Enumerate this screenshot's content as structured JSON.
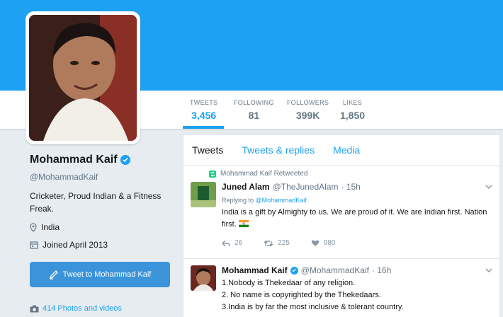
{
  "profile": {
    "name": "Mohammad Kaif",
    "handle": "@MohammadKaif",
    "bio": "Cricketer, Proud Indian & a Fitness Freak.",
    "location": "India",
    "joined": "Joined April 2013",
    "tweet_to_label": "Tweet to Mohammad Kaif",
    "photos_label": "414 Photos and videos"
  },
  "stats": [
    {
      "label": "TWEETS",
      "value": "3,456"
    },
    {
      "label": "FOLLOWING",
      "value": "81"
    },
    {
      "label": "FOLLOWERS",
      "value": "399K"
    },
    {
      "label": "LIKES",
      "value": "1,850"
    }
  ],
  "tabs": [
    "Tweets",
    "Tweets & replies",
    "Media"
  ],
  "tweets": [
    {
      "retweeted_by": "Mohammad Kaif Retweeted",
      "name": "Juned Alam",
      "handle": "@TheJunedAlam",
      "time": "· 15h",
      "replying_prefix": "Replying to",
      "replying_to": "@MohammadKaif",
      "text_line1": "India is a gift by Almighty to us. We are proud of it. We are Indian first. Nation",
      "text_line2": "first.",
      "replies": "26",
      "retweets": "225",
      "likes": "980"
    },
    {
      "name": "Mohammad Kaif",
      "handle": "@MohammadKaif",
      "time": "· 16h",
      "line1": "1.Nobody is Thekedaar of any religion.",
      "line2": "2. No name is copyrighted by the Thekedaars.",
      "line3": "3.India is by far the most inclusive & tolerant country."
    }
  ],
  "colors": {
    "accent": "#1da1f2",
    "button": "#3b94d9",
    "retweet": "#19cf86"
  }
}
